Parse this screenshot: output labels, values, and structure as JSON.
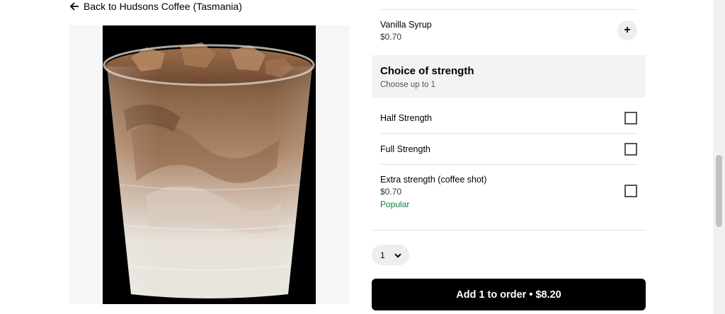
{
  "back_link": {
    "label": "Back to Hudsons Coffee (Tasmania)",
    "icon": "arrow-left-icon"
  },
  "product_image": {
    "subject": "iced-coffee-cup"
  },
  "options": {
    "vanilla": {
      "title": "Vanilla Syrup",
      "price": "$0.70",
      "add_icon": "plus-icon",
      "add_glyph": "+"
    },
    "strength_section": {
      "title": "Choice of strength",
      "subtitle": "Choose up to 1",
      "items": [
        {
          "label": "Half Strength",
          "checked": false
        },
        {
          "label": "Full Strength",
          "checked": false
        },
        {
          "label": "Extra strength (coffee shot)",
          "price": "$0.70",
          "badge": "Popular",
          "checked": false
        }
      ]
    }
  },
  "quantity": {
    "value": "1",
    "icon": "chevron-down-icon"
  },
  "add_button": {
    "label": "Add 1 to order • $8.20"
  },
  "colors": {
    "popular_green": "#0e8345",
    "button_bg": "#000000",
    "section_bg": "#f3f3f3"
  }
}
